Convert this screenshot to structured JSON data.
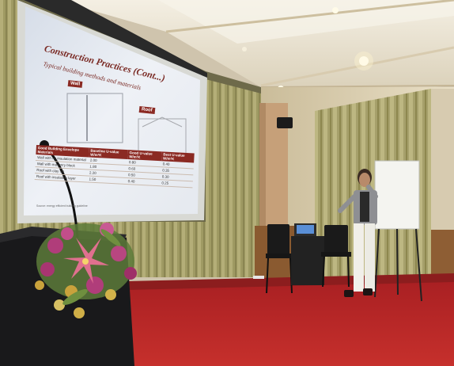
{
  "photo": {
    "subject": "presenter beside projected slide in a conference room",
    "colors": {
      "carpet": "#c0282a",
      "curtain": "#a8a36e",
      "wall": "#e8dcc0",
      "ceiling": "#efe9da",
      "screen": "#e9edf3",
      "podium": "#1a1a1c",
      "flowers": "#b03d7a"
    }
  },
  "slide": {
    "title": "Construction Practices (Cont...)",
    "subtitle": "Typical building methods and materials",
    "tag_left": "Wall",
    "tag_right": "Roof",
    "table": {
      "headers": [
        "Good Building Envelope Materials",
        "Baseline U-value W/m²K",
        "Good U-value W/m²K",
        "Best U-value W/m²K"
      ],
      "rows": [
        [
          "Wall with no insulation material",
          "2.00",
          "0.80",
          "0.40"
        ],
        [
          "Wall with masonry block",
          "1.80",
          "0.60",
          "0.35"
        ],
        [
          "Roof with clay tile",
          "2.20",
          "0.50",
          "0.30"
        ],
        [
          "Roof with insulation layer",
          "1.50",
          "0.40",
          "0.25"
        ]
      ]
    },
    "footnote": "Source: energy efficient building guideline"
  }
}
